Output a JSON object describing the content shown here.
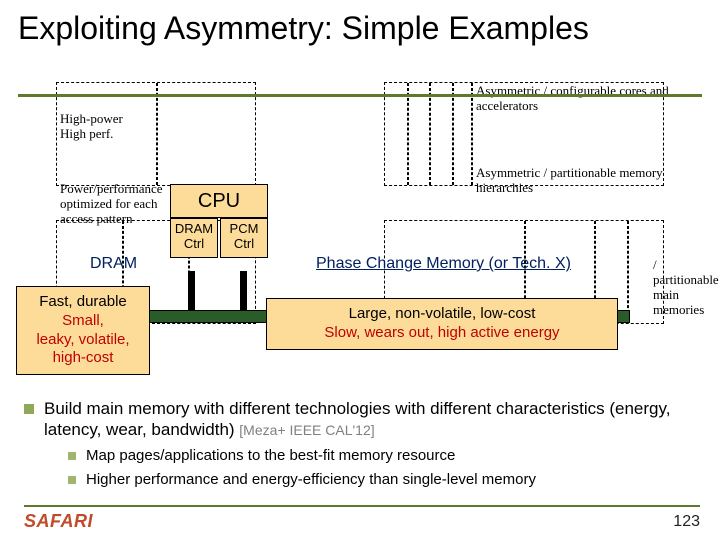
{
  "title": "Exploiting Asymmetry: Simple Examples",
  "labels": {
    "high_power": "High-power\nHigh perf.",
    "perf_pattern": "Power/performance optimized for each access pattern",
    "asym_cores": "Asymmetric / configurable cores and accelerators",
    "asym_mem": "Asymmetric / partitionable memory hierarchies",
    "partitionable_main": "/ partitionable main memories"
  },
  "cpu": "CPU",
  "ctrl": {
    "dram": "DRAM Ctrl",
    "pcm": "PCM Ctrl"
  },
  "mem": {
    "dram": "DRAM",
    "pcm_prefix": "Phase Change Memory",
    "pcm_suffix": " (or Tech. X)"
  },
  "callouts": {
    "left_l1": "Fast, durable",
    "left_l2": "Small,",
    "left_l3": "leaky, volatile,",
    "left_l4": "high-cost",
    "right_l1": "Large, non-volatile, low-cost",
    "right_l2": "Slow, wears out, high active energy"
  },
  "bullets": {
    "main": "Build main memory with different technologies with different characteristics (energy, latency, wear, bandwidth) ",
    "cite": "[Meza+ IEEE CAL'12]",
    "sub1": "Map pages/applications to the best-fit memory resource",
    "sub2": "Higher performance and energy-efficiency than single-level memory"
  },
  "footer": {
    "brand": "SAFARI",
    "page": "123"
  }
}
